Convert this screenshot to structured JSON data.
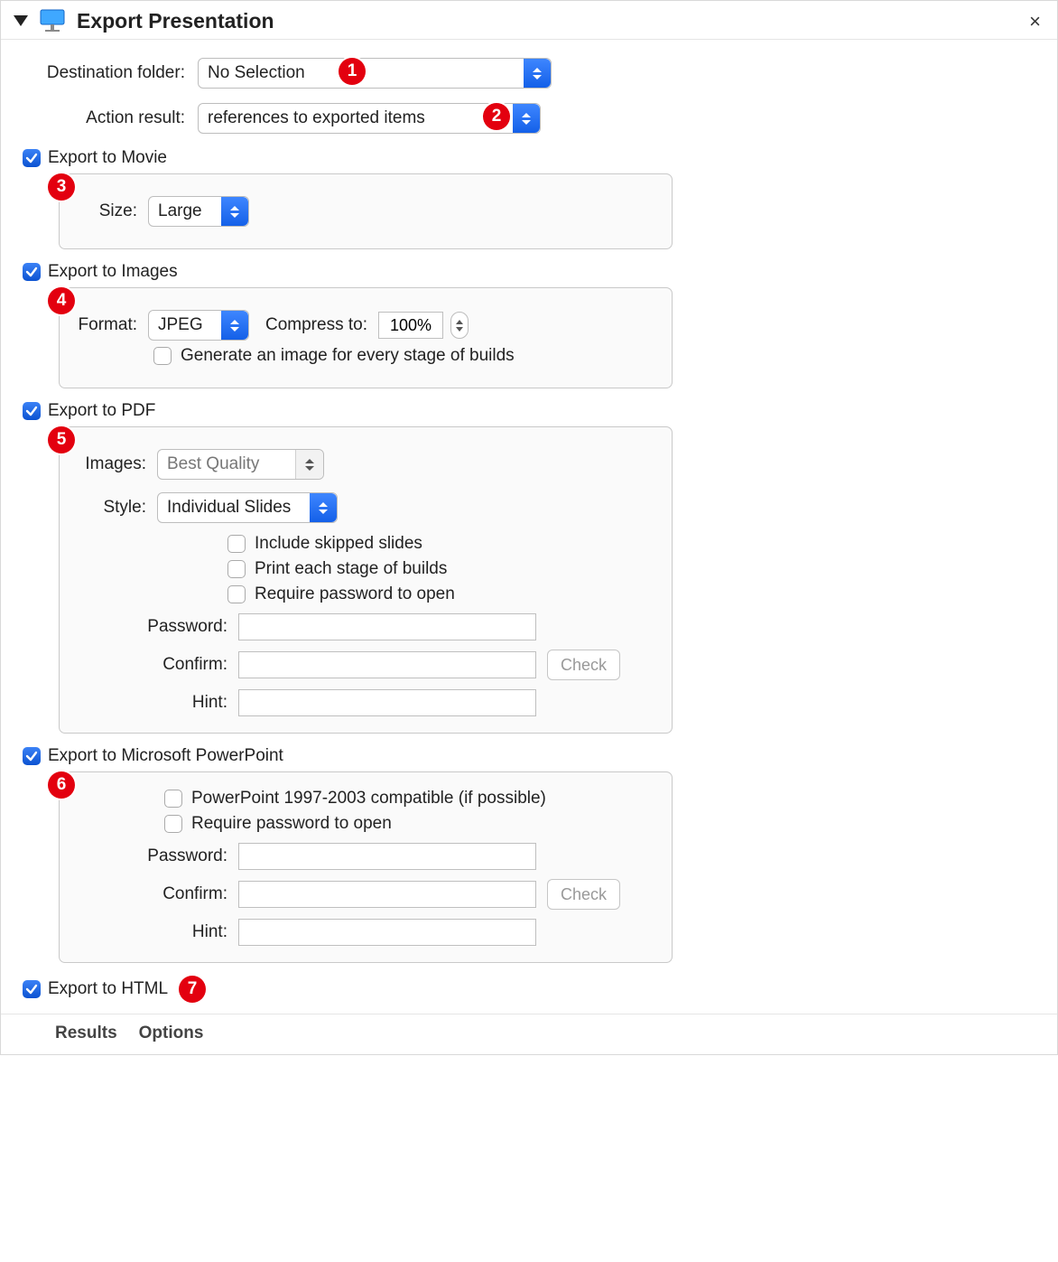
{
  "title": "Export Presentation",
  "top": {
    "destination_label": "Destination folder:",
    "destination_value": "No Selection",
    "action_label": "Action result:",
    "action_value": "references to exported items"
  },
  "movie": {
    "header": "Export to Movie",
    "size_label": "Size:",
    "size_value": "Large"
  },
  "images": {
    "header": "Export to Images",
    "format_label": "Format:",
    "format_value": "JPEG",
    "compress_label": "Compress to:",
    "compress_value": "100%",
    "builds_label": "Generate an image for every stage of builds"
  },
  "pdf": {
    "header": "Export to PDF",
    "images_label": "Images:",
    "images_value": "Best Quality",
    "style_label": "Style:",
    "style_value": "Individual Slides",
    "opt_skipped": "Include skipped slides",
    "opt_stage": "Print each stage of builds",
    "opt_pw": "Require password to open",
    "pw_label": "Password:",
    "confirm_label": "Confirm:",
    "hint_label": "Hint:",
    "check_btn": "Check"
  },
  "ppt": {
    "header": "Export to Microsoft PowerPoint",
    "opt_compat": "PowerPoint 1997-2003 compatible (if possible)",
    "opt_pw": "Require password to open",
    "pw_label": "Password:",
    "confirm_label": "Confirm:",
    "hint_label": "Hint:",
    "check_btn": "Check"
  },
  "html": {
    "header": "Export to HTML"
  },
  "footer": {
    "results": "Results",
    "options": "Options"
  },
  "badges": [
    "1",
    "2",
    "3",
    "4",
    "5",
    "6",
    "7"
  ]
}
